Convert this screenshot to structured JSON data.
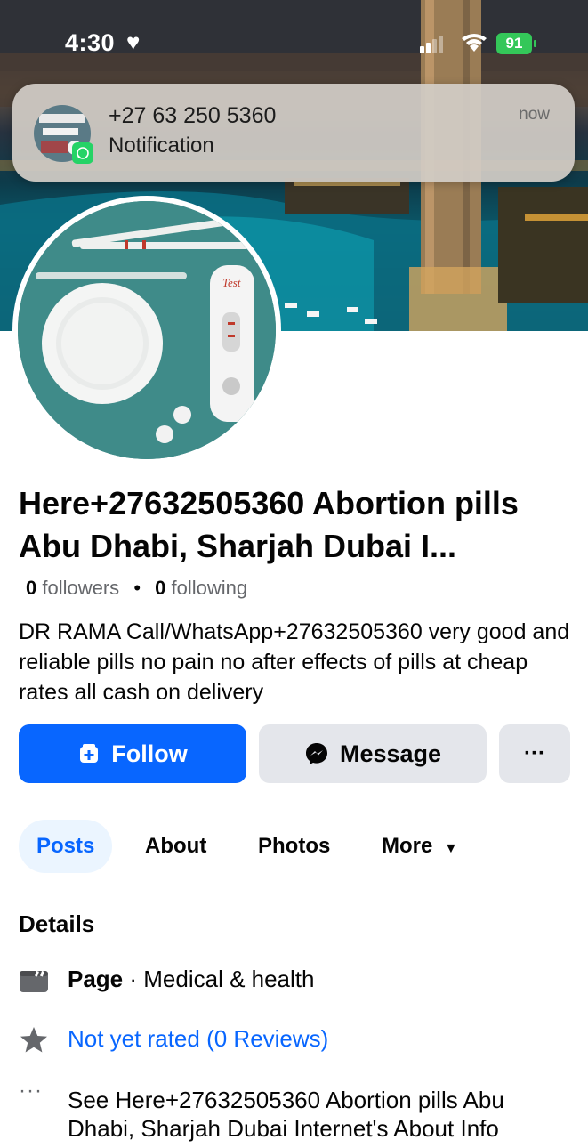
{
  "status_bar": {
    "time": "4:30",
    "battery": "91"
  },
  "notification": {
    "title": "+27 63 250 5360",
    "body": "Notification",
    "time": "now"
  },
  "page": {
    "name": "Here+27632505360 Abortion pills Abu Dhabi, Sharjah Dubai I...",
    "followers_count": "0",
    "followers_label": "followers",
    "following_count": "0",
    "following_label": "following",
    "bio": "DR RAMA Call/WhatsApp+27632505360 very good and reliable pills no pain no after effects of pills at cheap rates all cash on delivery",
    "avatar_test_label": "Test"
  },
  "actions": {
    "follow_label": "Follow",
    "message_label": "Message",
    "more_label": "···"
  },
  "tabs": [
    {
      "label": "Posts"
    },
    {
      "label": "About"
    },
    {
      "label": "Photos"
    },
    {
      "label": "More"
    }
  ],
  "details": {
    "title": "Details",
    "page_label": "Page",
    "category": " · Medical & health",
    "rating": "Not yet rated (0 Reviews)",
    "see_about": "See Here+27632505360 Abortion pills Abu Dhabi, Sharjah Dubai Internet's About Info"
  },
  "colors": {
    "accent": "#0866ff",
    "secondary_button": "#e4e6eb",
    "whatsapp": "#25d366",
    "battery": "#34c759"
  }
}
